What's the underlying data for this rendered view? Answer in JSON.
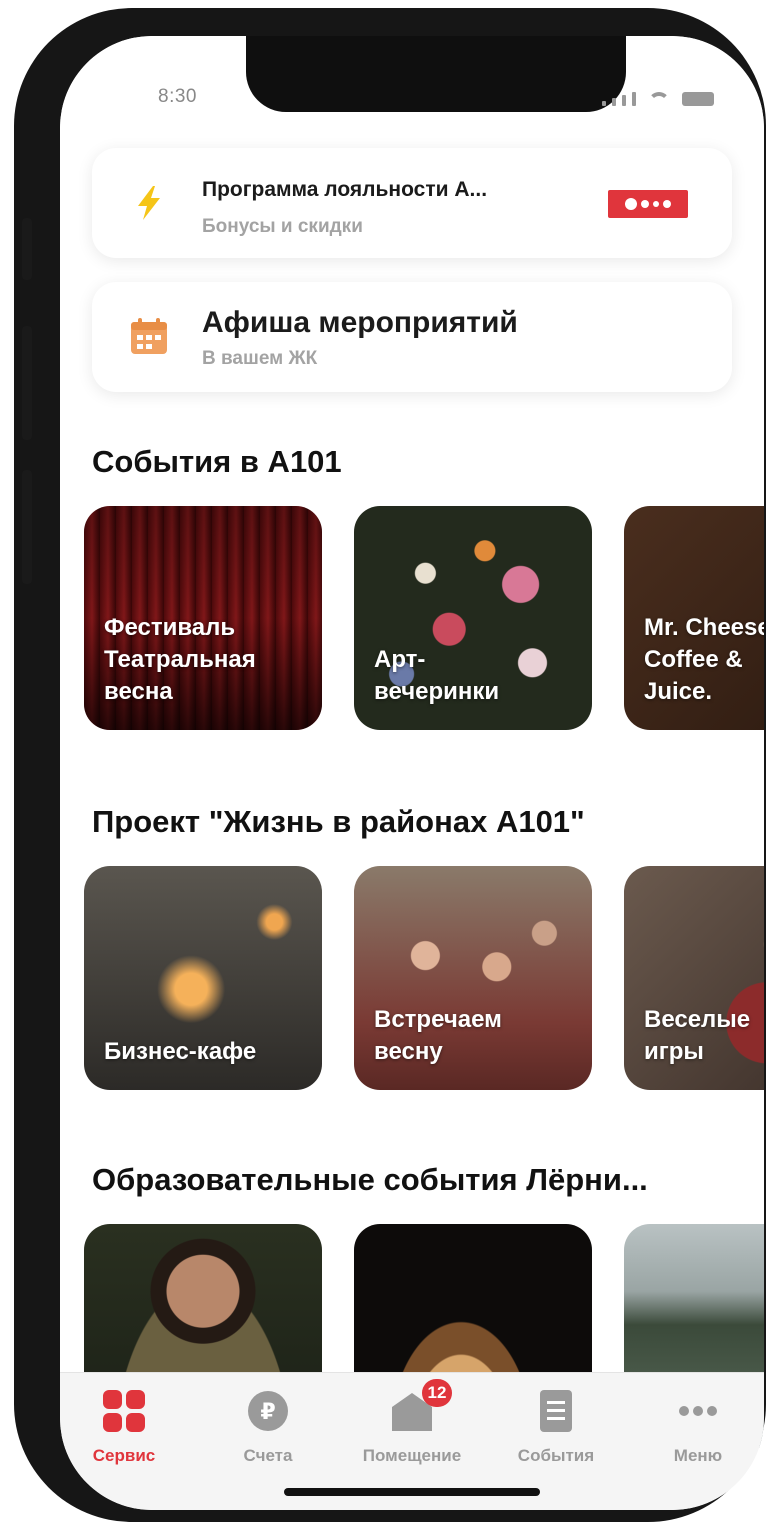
{
  "status_bar": {
    "time": "8:30"
  },
  "loyalty_card": {
    "title": "Программа лояльности А...",
    "subtitle": "Бонусы и скидки",
    "icon": "lightning-icon",
    "accent": "#f5c518"
  },
  "events_card": {
    "title": "Афиша мероприятий",
    "subtitle": "В вашем ЖК",
    "icon": "calendar-icon",
    "accent": "#f0a060"
  },
  "sections": [
    {
      "title": "События в А101",
      "tiles": [
        "Фестиваль\nТеатральная\nвесна",
        "Арт-\nвечеринки",
        "Mr. Cheese\nCoffee &\nJuice."
      ]
    },
    {
      "title": "Проект \"Жизнь в районах А101\"",
      "tiles": [
        "Бизнес-кафе",
        "Встречаем\nвесну",
        "Веселые\nигры"
      ]
    },
    {
      "title": "Образовательные события Лёрни...",
      "tiles": [
        "",
        "",
        ""
      ]
    }
  ],
  "tabbar": {
    "items": [
      {
        "label": "Сервис",
        "icon": "grid-icon",
        "active": true
      },
      {
        "label": "Счета",
        "icon": "ruble-icon",
        "active": false
      },
      {
        "label": "Помещение",
        "icon": "house-icon",
        "active": false,
        "badge": "12"
      },
      {
        "label": "События",
        "icon": "list-icon",
        "active": false
      },
      {
        "label": "Меню",
        "icon": "more-icon",
        "active": false
      }
    ]
  },
  "colors": {
    "brand_red": "#e0353c",
    "inactive_gray": "#9a9a9a"
  }
}
